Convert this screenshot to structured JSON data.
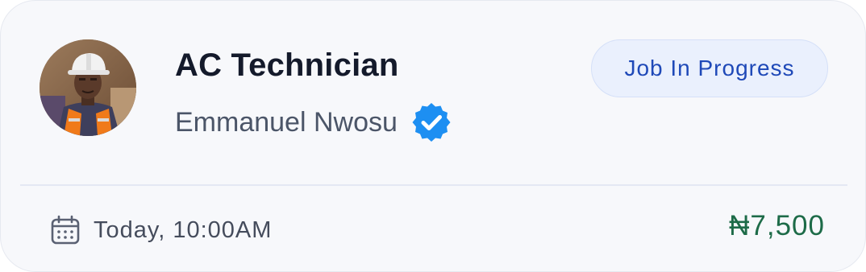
{
  "job": {
    "title": "AC Technician",
    "status": "Job In Progress",
    "schedule": "Today, 10:00AM",
    "price": "₦7,500"
  },
  "provider": {
    "name": "Emmanuel Nwosu",
    "verified": true,
    "avatar": "technician-photo"
  },
  "icons": {
    "verified": "verified-badge-icon",
    "calendar": "calendar-icon"
  },
  "colors": {
    "card_background": "#f7f8fb",
    "status_text": "#1f49b8",
    "status_background": "#eaf0fd",
    "verified_badge": "#1d8ff2",
    "price": "#1d6b48"
  }
}
